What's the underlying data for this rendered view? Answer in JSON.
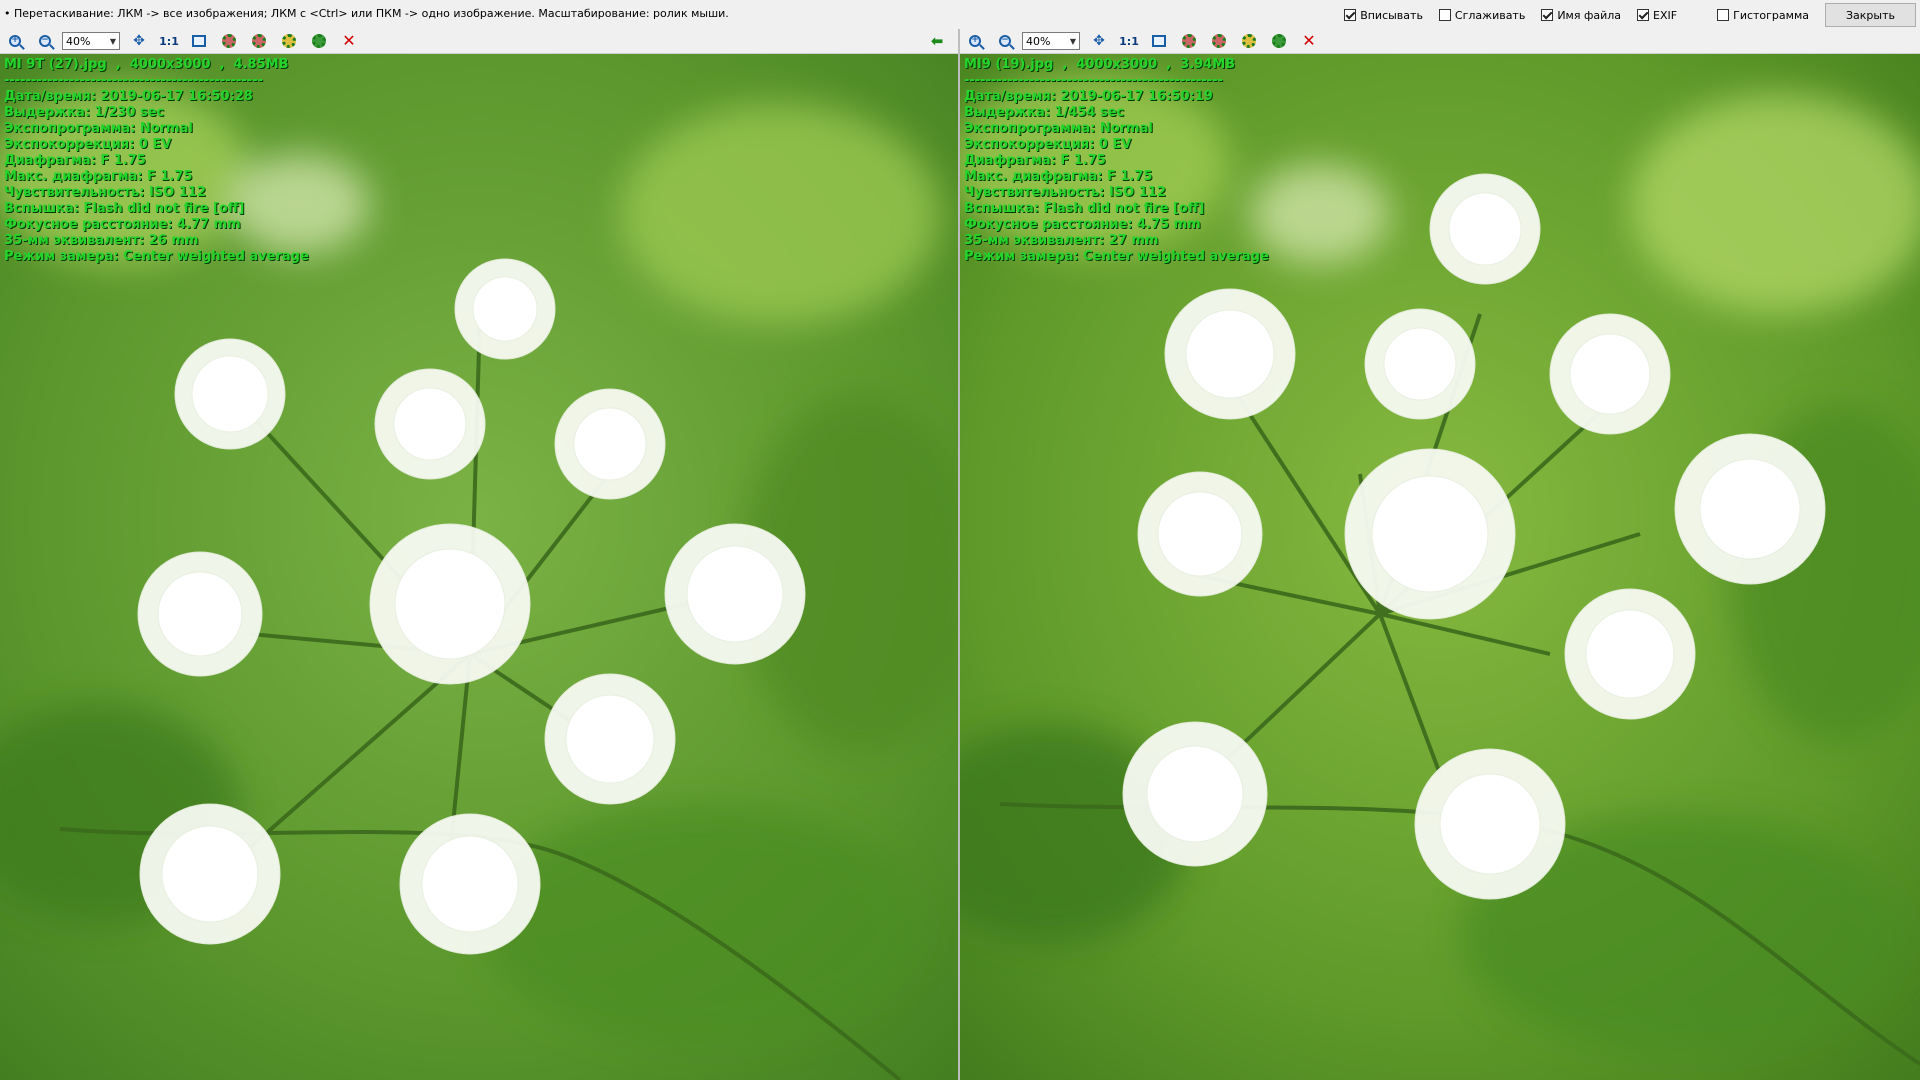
{
  "hint": "• Перетаскивание: ЛКМ -> все изображения; ЛКМ с <Ctrl> или ПКМ -> одно изображение. Масштабирование: ролик мыши.",
  "options": [
    {
      "label": "Вписывать",
      "checked": true
    },
    {
      "label": "Сглаживать",
      "checked": false
    },
    {
      "label": "Имя файла",
      "checked": true
    },
    {
      "label": "EXIF",
      "checked": true
    },
    {
      "label": "Гистограмма",
      "checked": false
    }
  ],
  "close_label": "Закрыть",
  "toolbar": {
    "zoom_value": "40%",
    "one_to_one": "1:1"
  },
  "colors": {
    "exif_text": "#24d42b",
    "foliage": "#6aa33a",
    "flower": "#ffffff"
  },
  "left": {
    "header": "MI 9T (27).jpg  ,  4000x3000  ,  4.85MB",
    "separator": "------------------------------------------------",
    "exif": [
      "Дата/время: 2019-06-17 16:50:28",
      "Выдержка: 1/230 sec",
      "Экспопрограмма: Normal",
      "Экспокоррекция: 0 EV",
      "Диафрагма: F 1.75",
      "Макс. диафрагма: F 1.75",
      "Чувствительность: ISO 112",
      "Вспышка: Flash did not fire [off]",
      "Фокусное расстояние: 4.77 mm",
      "35-мм эквивалент: 26 mm",
      "Режим замера: Center weighted average"
    ]
  },
  "right": {
    "header": "MI9 (19).jpg  ,  4000x3000  ,  3.94MB",
    "separator": "------------------------------------------------",
    "exif": [
      "Дата/время: 2019-06-17 16:50:19",
      "Выдержка: 1/454 sec",
      "Экспопрограмма: Normal",
      "Экспокоррекция: 0 EV",
      "Диафрагма: F 1.75",
      "Макс. диафрагма: F 1.75",
      "Чувствительность: ISO 112",
      "Вспышка: Flash did not fire [off]",
      "Фокусное расстояние: 4.75 mm",
      "35-мм эквивалент: 27 mm",
      "Режим замера: Center weighted average"
    ]
  }
}
